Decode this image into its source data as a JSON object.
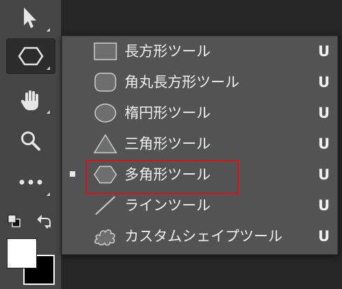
{
  "toolbar": {
    "tools": [
      {
        "name": "move-tool",
        "icon": "arrow-cursor-icon"
      },
      {
        "name": "shape-tool",
        "icon": "hexagon-icon",
        "active": true
      },
      {
        "name": "hand-tool",
        "icon": "hand-icon"
      },
      {
        "name": "zoom-tool",
        "icon": "magnifier-icon"
      },
      {
        "name": "more-tools",
        "icon": "ellipsis-icon"
      }
    ],
    "foreground_color": "#ffffff",
    "background_color": "#000000"
  },
  "flyout": {
    "items": [
      {
        "label": "長方形ツール",
        "shortcut": "U",
        "icon": "rectangle-icon",
        "selected": false
      },
      {
        "label": "角丸長方形ツール",
        "shortcut": "U",
        "icon": "rounded-rectangle-icon",
        "selected": false
      },
      {
        "label": "楕円形ツール",
        "shortcut": "U",
        "icon": "ellipse-icon",
        "selected": false
      },
      {
        "label": "三角形ツール",
        "shortcut": "U",
        "icon": "triangle-icon",
        "selected": false
      },
      {
        "label": "多角形ツール",
        "shortcut": "U",
        "icon": "polygon-icon",
        "selected": true
      },
      {
        "label": "ラインツール",
        "shortcut": "U",
        "icon": "line-icon",
        "selected": false
      },
      {
        "label": "カスタムシェイプツール",
        "shortcut": "U",
        "icon": "custom-shape-icon",
        "selected": false
      }
    ],
    "highlight_color": "#d7141a"
  }
}
